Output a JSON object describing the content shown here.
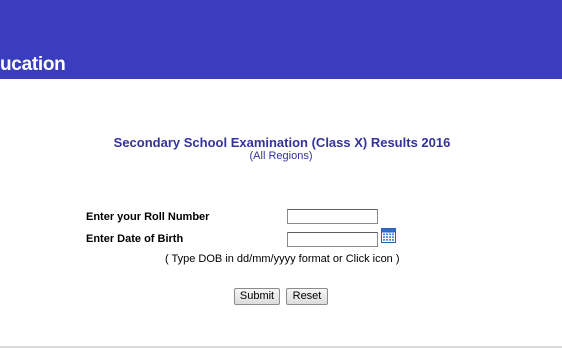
{
  "header": {
    "title": "ucation",
    "background_color": "#3b3dbf"
  },
  "exam": {
    "title": "Secondary School Examination (Class X) Results 2016",
    "subtitle": "(All Regions)"
  },
  "form": {
    "roll_label": "Enter your Roll Number",
    "roll_value": "",
    "dob_label": "Enter Date of Birth",
    "dob_value": "",
    "calendar_icon": "calendar-icon",
    "dob_hint": "( Type DOB in dd/mm/yyyy format or Click icon )",
    "submit_label": "Submit",
    "reset_label": "Reset"
  }
}
